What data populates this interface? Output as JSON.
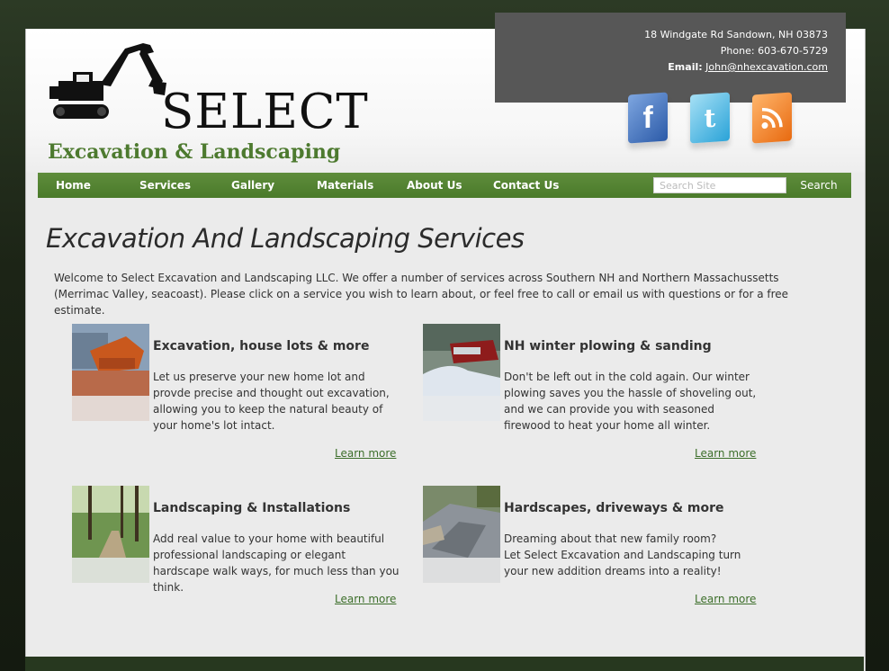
{
  "brand": {
    "name_line1": "SELECT",
    "name_line2": "Excavation & Landscaping",
    "accent_color": "#4d7a2f"
  },
  "contact": {
    "address": "18 Windgate Rd Sandown, NH 03873",
    "phone": "Phone: 603-670-5729",
    "email_label": "Email:",
    "email": "John@nhexcavation.com"
  },
  "social": {
    "facebook_glyph": "f",
    "twitter_glyph": "t",
    "icons": [
      "facebook-icon",
      "twitter-icon",
      "rss-icon"
    ]
  },
  "nav": {
    "items": [
      "Home",
      "Services",
      "Gallery",
      "Materials",
      "About Us",
      "Contact Us"
    ],
    "search_placeholder": "Search Site",
    "search_button": "Search"
  },
  "main": {
    "title": "Excavation And Landscaping Services",
    "intro": "Welcome to Select Excavation and Landscaping LLC. We offer a number of services across Southern NH and Northern Massachussetts (Merrimac Valley, seacoast). Please click on a service you wish to learn about, or feel free to call or email us with questions or for a free estimate."
  },
  "services": [
    {
      "title": "Excavation, house lots & more",
      "description": "Let us preserve your new home lot and provde precise and thought out excavation, allowing you to keep the natural beauty of your home's lot intact.",
      "link": "Learn more"
    },
    {
      "title": "NH winter plowing & sanding",
      "description": "Don't be left out in the cold again. Our winter plowing saves you the hassle of shoveling out, and we can provide you with seasoned firewood to heat your home all winter.",
      "link": "Learn more"
    },
    {
      "title": "Landscaping & Installations",
      "description": "Add real value to your home with beautiful professional landscaping or elegant hardscape walk ways, for much less than you think.",
      "link": "Learn more"
    },
    {
      "title": "Hardscapes, driveways & more",
      "description_line1": "Dreaming about that new family room?",
      "description_line2": "Let Select Excavation and Landscaping turn your new addition dreams into a reality!",
      "link": "Learn more"
    }
  ]
}
